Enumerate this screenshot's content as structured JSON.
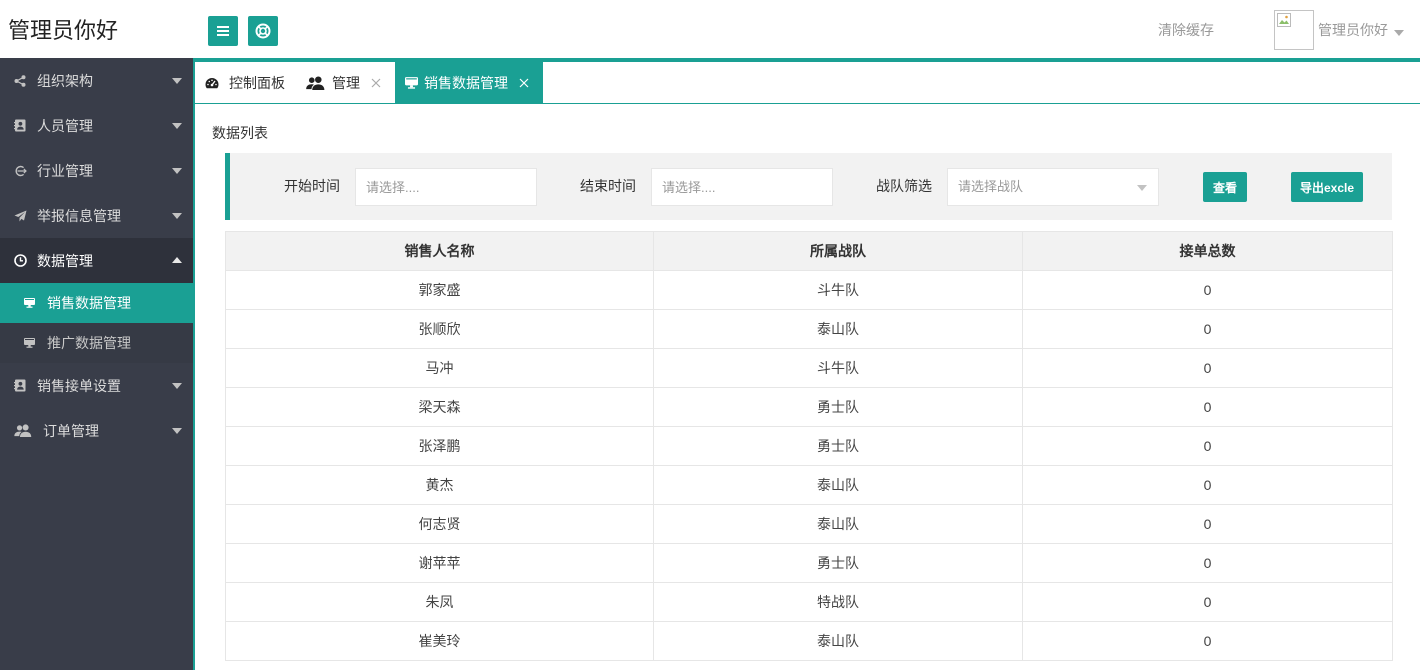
{
  "header": {
    "logo_text": "管理员你好",
    "menu_toggle_icon": "menu-icon",
    "help_icon": "lifebuoy-icon",
    "clear_cache": "清除缓存",
    "username": "管理员你好"
  },
  "sidebar": {
    "items": [
      {
        "label": "组织架构",
        "icon": "share-icon",
        "expanded": false
      },
      {
        "label": "人员管理",
        "icon": "contact-card-icon",
        "expanded": false
      },
      {
        "label": "行业管理",
        "icon": "industry-icon",
        "expanded": false
      },
      {
        "label": "举报信息管理",
        "icon": "paper-plane-icon",
        "expanded": false
      },
      {
        "label": "数据管理",
        "icon": "clock-icon",
        "expanded": true,
        "children": [
          {
            "label": "销售数据管理",
            "icon": "monitor-icon",
            "selected": true
          },
          {
            "label": "推广数据管理",
            "icon": "monitor-icon",
            "selected": false
          }
        ]
      },
      {
        "label": "销售接单设置",
        "icon": "contact-card-icon",
        "expanded": false
      },
      {
        "label": "订单管理",
        "icon": "users-icon",
        "expanded": false
      }
    ]
  },
  "tabs": [
    {
      "label": "控制面板",
      "icon": "dashboard-icon",
      "closable": false,
      "active": false
    },
    {
      "label": "管理",
      "icon": "users-icon",
      "closable": true,
      "active": false
    },
    {
      "label": "销售数据管理",
      "icon": "monitor-icon",
      "closable": true,
      "active": true
    }
  ],
  "content": {
    "section_title": "数据列表",
    "filter": {
      "start_label": "开始时间",
      "start_placeholder": "请选择....",
      "end_label": "结束时间",
      "end_placeholder": "请选择....",
      "team_label": "战队筛选",
      "team_placeholder": "请选择战队",
      "search_button": "查看",
      "export_button": "导出excle"
    },
    "table": {
      "headers": [
        "销售人名称",
        "所属战队",
        "接单总数"
      ],
      "rows": [
        [
          "郭家盛",
          "斗牛队",
          0
        ],
        [
          "张顺欣",
          "泰山队",
          0
        ],
        [
          "马冲",
          "斗牛队",
          0
        ],
        [
          "梁天森",
          "勇士队",
          0
        ],
        [
          "张泽鹏",
          "勇士队",
          0
        ],
        [
          "黄杰",
          "泰山队",
          0
        ],
        [
          "何志贤",
          "泰山队",
          0
        ],
        [
          "谢苹苹",
          "勇士队",
          0
        ],
        [
          "朱凤",
          "特战队",
          0
        ],
        [
          "崔美玲",
          "泰山队",
          0
        ]
      ]
    }
  },
  "colors": {
    "accent": "#1aa094",
    "sidebar_bg": "#393d49",
    "sidebar_active_bg": "#2e313b",
    "filter_bg": "#f2f2f2",
    "table_border": "#e6e6e6"
  }
}
